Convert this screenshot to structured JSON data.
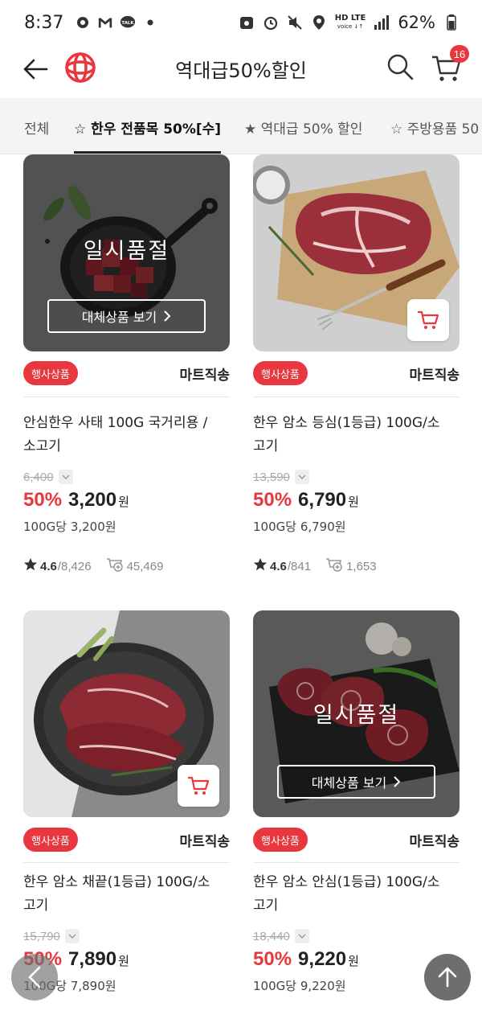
{
  "status_bar": {
    "time": "8:37",
    "battery": "62%"
  },
  "header": {
    "title": "역대급50%할인",
    "cart_count": "16"
  },
  "tabs": [
    {
      "label": "전체"
    },
    {
      "label": "☆ 한우 전품목 50%[수]"
    },
    {
      "label": "★ 역대급 50% 할인"
    },
    {
      "label": "☆ 주방용품 50"
    }
  ],
  "products": [
    {
      "badge": "행사상품",
      "delivery": "마트직송",
      "name_line1": "안심한우 사태 100G 국거리용 /",
      "name_line2": "소고기",
      "original_price": "6,400",
      "discount": "50%",
      "price": "3,200",
      "currency": "원",
      "unit_price": "100G당 3,200원",
      "rating": "4.6",
      "review_count": "/8,426",
      "cart_count": "45,469",
      "sold_out": "일시품절",
      "alt_button": "대체상품 보기"
    },
    {
      "badge": "행사상품",
      "delivery": "마트직송",
      "name_line1": "한우 암소 등심(1등급) 100G/소",
      "name_line2": "고기",
      "original_price": "13,590",
      "discount": "50%",
      "price": "6,790",
      "currency": "원",
      "unit_price": "100G당 6,790원",
      "rating": "4.6",
      "review_count": "/841",
      "cart_count": "1,653"
    },
    {
      "badge": "행사상품",
      "delivery": "마트직송",
      "name_line1": "한우 암소 채끝(1등급) 100G/소",
      "name_line2": "고기",
      "original_price": "15,790",
      "discount": "50%",
      "price": "7,890",
      "currency": "원",
      "unit_price": "100G당 7,890원"
    },
    {
      "badge": "행사상품",
      "delivery": "마트직송",
      "name_line1": "한우 암소 안심(1등급) 100G/소",
      "name_line2": "고기",
      "original_price": "18,440",
      "discount": "50%",
      "price": "9,220",
      "currency": "원",
      "unit_price": "100G당 9,220원",
      "sold_out": "일시품절",
      "alt_button": "대체상품 보기"
    }
  ],
  "colors": {
    "accent": "#e8373e",
    "tab_bg": "#f4f4f6"
  }
}
